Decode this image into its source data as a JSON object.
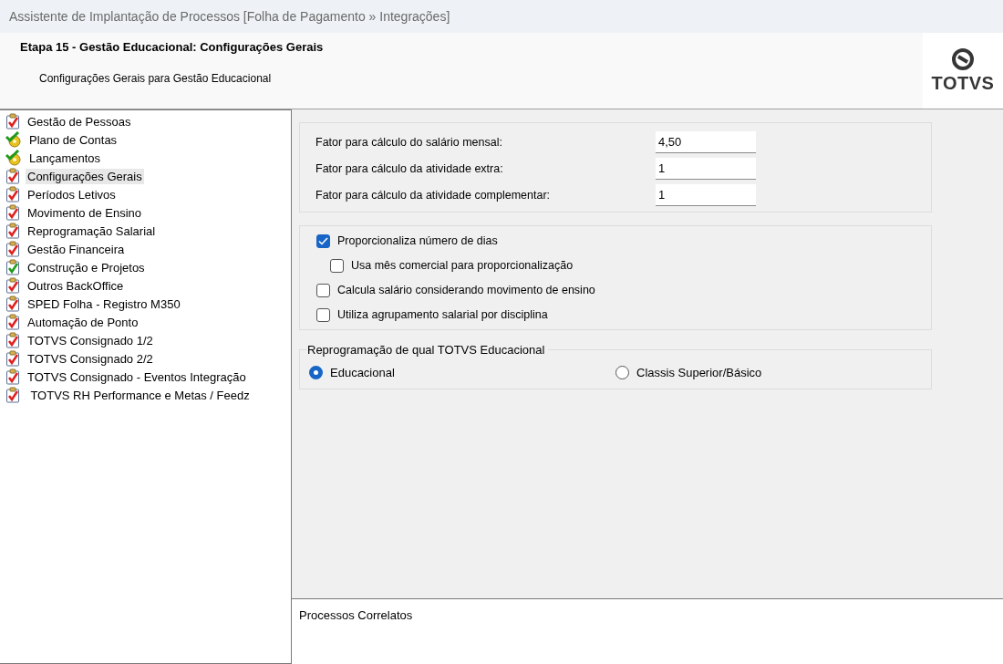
{
  "window": {
    "title": "Assistente de Implantação de Processos [Folha de Pagamento » Integrações]"
  },
  "header": {
    "title": "Etapa 15 - Gestão Educacional: Configurações Gerais",
    "subtitle": "Configurações Gerais para Gestão Educacional",
    "logo_text": "TOTVS"
  },
  "steps": [
    {
      "label": "Gestão de Pessoas",
      "kind": "todo",
      "selected": false
    },
    {
      "label": "Plano de Contas",
      "kind": "auto",
      "selected": false
    },
    {
      "label": "Lançamentos",
      "kind": "auto",
      "selected": false
    },
    {
      "label": "Configurações Gerais",
      "kind": "todo",
      "selected": true
    },
    {
      "label": "Períodos Letivos",
      "kind": "todo",
      "selected": false
    },
    {
      "label": "Movimento de Ensino",
      "kind": "todo",
      "selected": false
    },
    {
      "label": "Reprogramação Salarial",
      "kind": "todo",
      "selected": false
    },
    {
      "label": "Gestão Financeira",
      "kind": "todo",
      "selected": false
    },
    {
      "label": "Construção e Projetos",
      "kind": "done",
      "selected": false
    },
    {
      "label": "Outros BackOffice",
      "kind": "todo",
      "selected": false
    },
    {
      "label": "SPED Folha - Registro M350",
      "kind": "todo",
      "selected": false
    },
    {
      "label": "Automação de Ponto",
      "kind": "todo",
      "selected": false
    },
    {
      "label": "TOTVS Consignado 1/2",
      "kind": "todo",
      "selected": false
    },
    {
      "label": "TOTVS Consignado 2/2",
      "kind": "todo",
      "selected": false
    },
    {
      "label": "TOTVS Consignado - Eventos Integração",
      "kind": "todo",
      "selected": false
    },
    {
      "label": " TOTVS RH Performance e Metas / Feedz",
      "kind": "todo",
      "selected": false
    }
  ],
  "factors": [
    {
      "label": "Fator para cálculo do salário mensal:",
      "value": "4,50"
    },
    {
      "label": "Fator para cálculo da atividade extra:",
      "value": "1"
    },
    {
      "label": "Fator para cálculo da atividade complementar:",
      "value": "1"
    }
  ],
  "options": [
    {
      "label": "Proporcionaliza número de dias",
      "checked": true,
      "children": [
        {
          "label": "Usa mês comercial para proporcionalização",
          "checked": false
        }
      ]
    },
    {
      "label": "Calcula salário considerando movimento de ensino",
      "checked": false
    },
    {
      "label": "Utiliza agrupamento salarial por disciplina",
      "checked": false
    }
  ],
  "reprogramming": {
    "legend": "Reprogramação de qual TOTVS Educacional",
    "choices": [
      {
        "label": "Educacional",
        "selected": true
      },
      {
        "label": "Classis Superior/Básico",
        "selected": false
      }
    ]
  },
  "related": {
    "title": "Processos Correlatos"
  }
}
